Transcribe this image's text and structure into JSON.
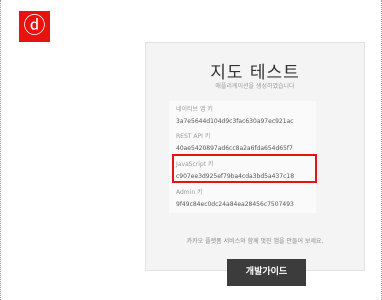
{
  "step_badge": "ⓓ",
  "card": {
    "title": "지도 테스트",
    "subtitle": "애플리케이션을 생성하였습니다",
    "keys": [
      {
        "label": "네이티브 앱 키",
        "value": "3a7e5644d104d9c3fac630a97ec921ac"
      },
      {
        "label": "REST API 키",
        "value": "40ae5420897ad6cc8a2a6fda654d65f7"
      },
      {
        "label": "JavaScript 키",
        "value": "c907ee3d925ef79ba4cda3bd5a437c18"
      },
      {
        "label": "Admin 키",
        "value": "9f49c84ec0dc24a84ea28456c7507493"
      }
    ],
    "footer": "카카오 플랫폼 서비스와 함께 멋진 앱을 만들어 보세요.",
    "button": "개발가이드"
  }
}
